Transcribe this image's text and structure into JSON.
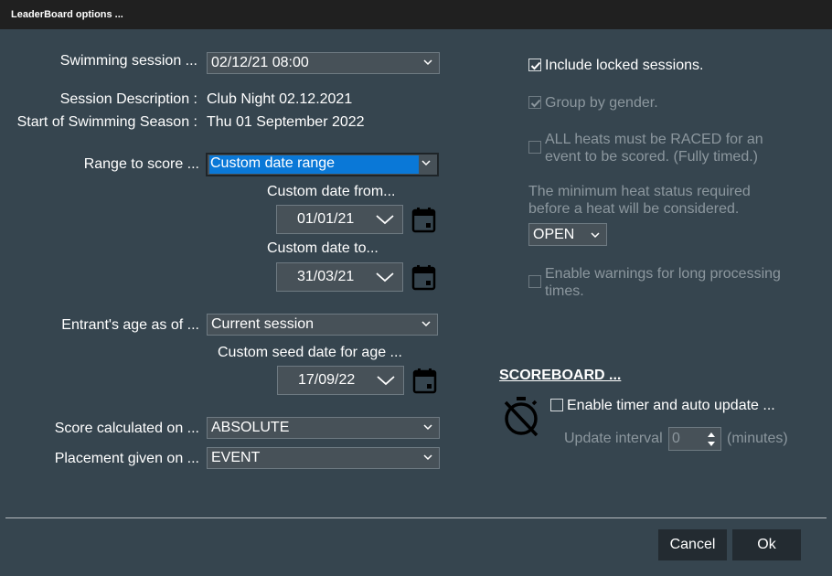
{
  "window": {
    "title": "LeaderBoard options ..."
  },
  "left": {
    "swimming_session": {
      "label": "Swimming session ...",
      "value": "02/12/21 08:00"
    },
    "session_description": {
      "label": "Session Description :",
      "value": "Club Night 02.12.2021"
    },
    "season_start": {
      "label": "Start of Swimming Season :",
      "value": "Thu 01 September 2022"
    },
    "range_to_score": {
      "label": "Range to score ...",
      "value": "Custom date range"
    },
    "custom_date_from": {
      "label": "Custom date from...",
      "value": "01/01/21"
    },
    "custom_date_to": {
      "label": "Custom date to...",
      "value": "31/03/21"
    },
    "entrant_age": {
      "label": "Entrant's age as of ...",
      "value": "Current session"
    },
    "custom_seed_date": {
      "label": "Custom seed date for age ...",
      "value": "17/09/22"
    },
    "score_calculated_on": {
      "label": "Score calculated on ...",
      "value": "ABSOLUTE"
    },
    "placement_given_on": {
      "label": "Placement given on ...",
      "value": "EVENT"
    }
  },
  "right": {
    "include_locked": {
      "label": "Include locked sessions.",
      "checked": true,
      "enabled": true
    },
    "group_by_gender": {
      "label": "Group by gender.",
      "checked": true,
      "enabled": false
    },
    "all_heats_raced": {
      "label_line1": "ALL heats must be RACED for an",
      "label_line2": "event to be scored. (Fully timed.)",
      "checked": false,
      "enabled": false
    },
    "min_heat_status": {
      "label_line1": "The minimum heat status required",
      "label_line2": "before a heat will be considered.",
      "value": "OPEN"
    },
    "enable_warnings": {
      "label_line1": "Enable warnings for long processing",
      "label_line2": "times.",
      "checked": false,
      "enabled": false
    }
  },
  "scoreboard": {
    "heading": "SCOREBOARD  ...",
    "icon": "timer-off-icon",
    "enable_timer": {
      "label": "Enable timer and auto update ...",
      "checked": false
    },
    "update_interval": {
      "label": "Update interval",
      "value": "0",
      "unit": "(minutes)"
    }
  },
  "buttons": {
    "cancel": "Cancel",
    "ok": "Ok"
  },
  "colors": {
    "background": "#36454f",
    "titlebar": "#202020",
    "highlight": "#0a78d7",
    "button": "#232b31",
    "disabled_text": "#8c979e"
  }
}
